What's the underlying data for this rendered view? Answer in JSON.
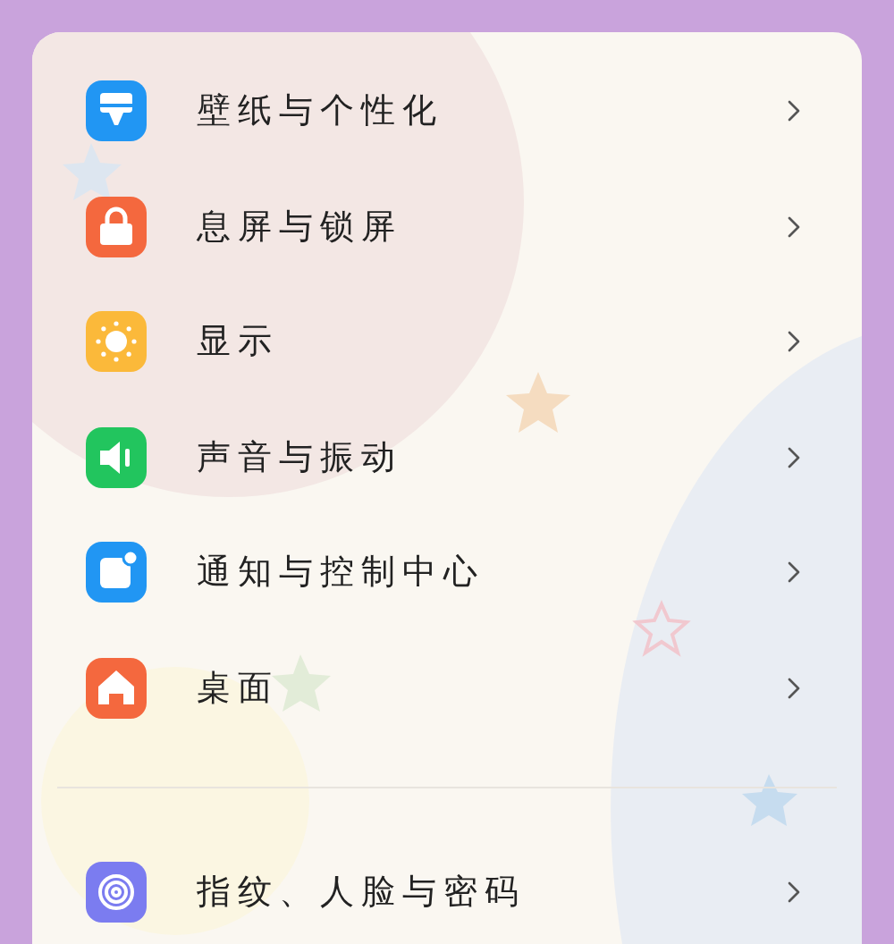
{
  "settings_groups": [
    {
      "items": [
        {
          "label": "壁纸与个性化",
          "kind": "wallpaper",
          "color": "#2196f3"
        },
        {
          "label": "息屏与锁屏",
          "kind": "lock",
          "color": "#f4683e"
        },
        {
          "label": "显示",
          "kind": "display",
          "color": "#fbb93a"
        },
        {
          "label": "声音与振动",
          "kind": "sound",
          "color": "#22c55e"
        },
        {
          "label": "通知与控制中心",
          "kind": "notification",
          "color": "#2196f3"
        },
        {
          "label": "桌面",
          "kind": "home",
          "color": "#f4683e"
        }
      ]
    },
    {
      "items": [
        {
          "label": "指纹、人脸与密码",
          "kind": "fingerprint",
          "color": "#7b7cf0"
        }
      ]
    }
  ]
}
